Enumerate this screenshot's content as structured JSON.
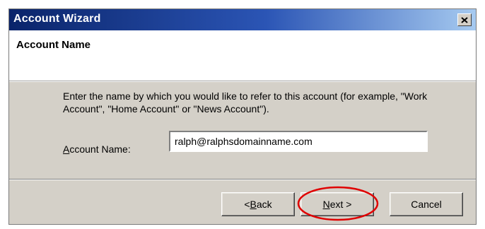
{
  "window": {
    "title": "Account Wizard",
    "close_icon": "close-x-icon"
  },
  "header": {
    "title": "Account Name"
  },
  "body": {
    "description": "Enter the name by which you would like to refer to this account (for example, \"Work Account\", \"Home Account\" or \"News Account\").",
    "field_label_underlined": "A",
    "field_label_rest": "ccount Name:",
    "account_name_value": "ralph@ralphsdomainname.com"
  },
  "buttons": {
    "back_prefix": "< ",
    "back_underlined": "B",
    "back_rest": "ack",
    "next_underlined": "N",
    "next_rest": "ext >",
    "cancel_label": "Cancel"
  },
  "colors": {
    "titlebar_start": "#0a246a",
    "titlebar_end": "#a6caf0",
    "dialog_face": "#d4d0c8",
    "highlight_ellipse": "#e00000"
  }
}
